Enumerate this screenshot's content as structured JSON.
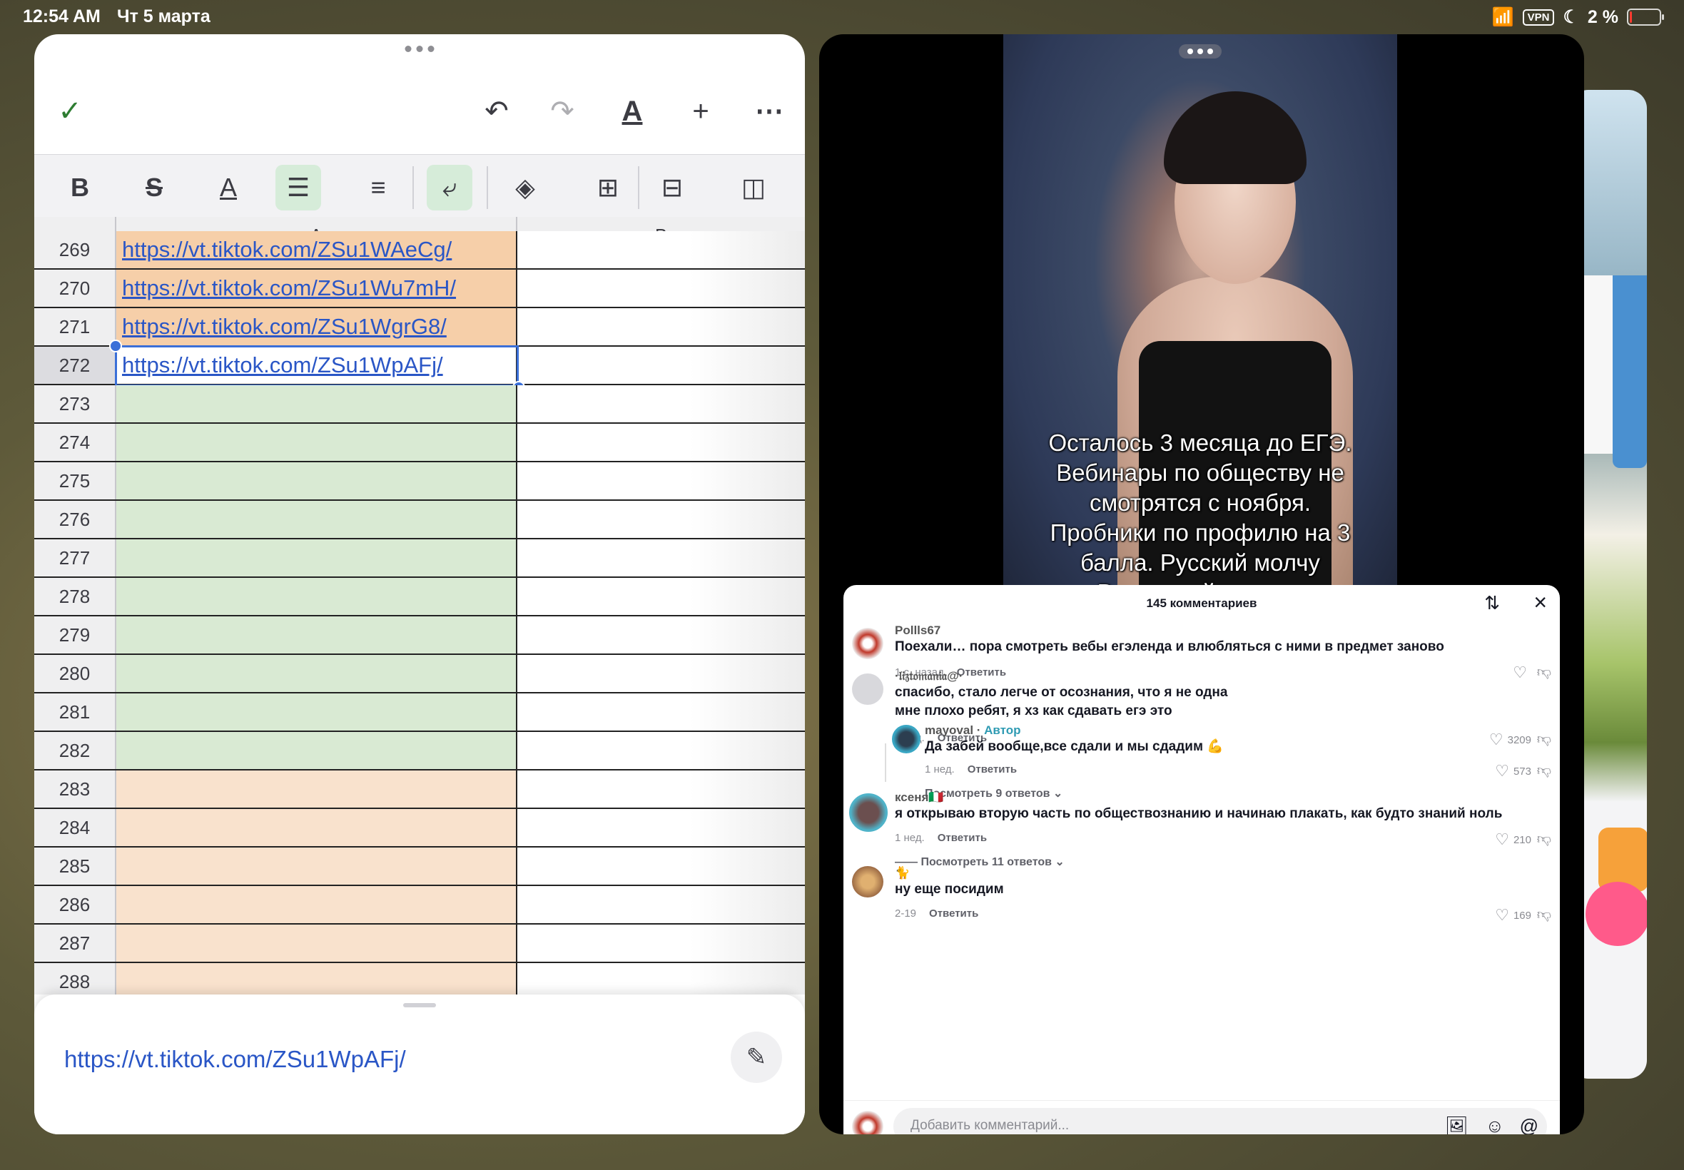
{
  "status": {
    "time": "12:54 AM",
    "date": "Чт 5 марта",
    "vpn": "VPN",
    "battery": "2 %",
    "battery_level": 0.02
  },
  "sheets": {
    "columns": [
      "A",
      "B"
    ],
    "rows": [
      {
        "num": "269",
        "a": "https://vt.tiktok.com/ZSu1WAeCg/",
        "fill": "orange"
      },
      {
        "num": "270",
        "a": "https://vt.tiktok.com/ZSu1Wu7mH/",
        "fill": "orange"
      },
      {
        "num": "271",
        "a": "https://vt.tiktok.com/ZSu1WgrG8/",
        "fill": "orange"
      },
      {
        "num": "272",
        "a": "https://vt.tiktok.com/ZSu1WpAFj/",
        "fill": "white"
      },
      {
        "num": "273",
        "a": "",
        "fill": "green"
      },
      {
        "num": "274",
        "a": "",
        "fill": "green"
      },
      {
        "num": "275",
        "a": "",
        "fill": "green"
      },
      {
        "num": "276",
        "a": "",
        "fill": "green"
      },
      {
        "num": "277",
        "a": "",
        "fill": "green"
      },
      {
        "num": "278",
        "a": "",
        "fill": "green"
      },
      {
        "num": "279",
        "a": "",
        "fill": "green"
      },
      {
        "num": "280",
        "a": "",
        "fill": "green"
      },
      {
        "num": "281",
        "a": "",
        "fill": "green"
      },
      {
        "num": "282",
        "a": "",
        "fill": "green"
      },
      {
        "num": "283",
        "a": "",
        "fill": "peach"
      },
      {
        "num": "284",
        "a": "",
        "fill": "peach"
      },
      {
        "num": "285",
        "a": "",
        "fill": "peach"
      },
      {
        "num": "286",
        "a": "",
        "fill": "peach"
      },
      {
        "num": "287",
        "a": "",
        "fill": "peach"
      },
      {
        "num": "288",
        "a": "",
        "fill": "peach"
      }
    ],
    "selected_row": "272",
    "formula_value": "https://vt.tiktok.com/ZSu1WpAFj/",
    "colors": {
      "orange": "#f6cfa9",
      "green": "#d9ead3",
      "peach": "#f9e2cd",
      "white": "#ffffff",
      "accent": "#2e7d32"
    }
  },
  "tiktok": {
    "caption": [
      "Осталось 3 месяца до ЕГЭ.",
      "Вебинары по обществу не",
      "смотрятся с ноября.",
      "Пробники по профилю на 3",
      "балла. Русский молчу",
      "Выпускной скоро..."
    ],
    "comments_title": "145 комментариев",
    "reply_label": "Ответить",
    "author_label": "Автор",
    "comments": [
      {
        "user": "Pollls67",
        "text": "Поехали… пора смотреть вебы егэленда и влюбляться с ними в предмет заново",
        "time": "1 с. назад",
        "likes": ""
      },
      {
        "user": "·𝔩𝔦𝔷𝔱𝔬𝔪𝔞𝔫𝔦𝔞@·",
        "text": "спасибо, стало легче от осознания, что я не одна\nмне плохо ребят, я хз как сдавать егэ это",
        "time": "1 нед.",
        "likes": "3209"
      },
      {
        "user": "mayoval",
        "text": "Да забей вообще,все сдали и мы сдадим 💪",
        "time": "1 нед.",
        "likes": "573",
        "more": "Посмотреть 9 ответов"
      },
      {
        "user": "ксеня🇮🇹",
        "text": "я открываю вторую часть по обществознанию и начинаю плакать, как будто знаний ноль",
        "time": "1 нед.",
        "likes": "210",
        "more": "Посмотреть 11 ответов"
      },
      {
        "user": "🐈",
        "text": "ну еще посидим",
        "time": "2-19",
        "likes": "169"
      }
    ],
    "input_placeholder": "Добавить комментарий..."
  }
}
